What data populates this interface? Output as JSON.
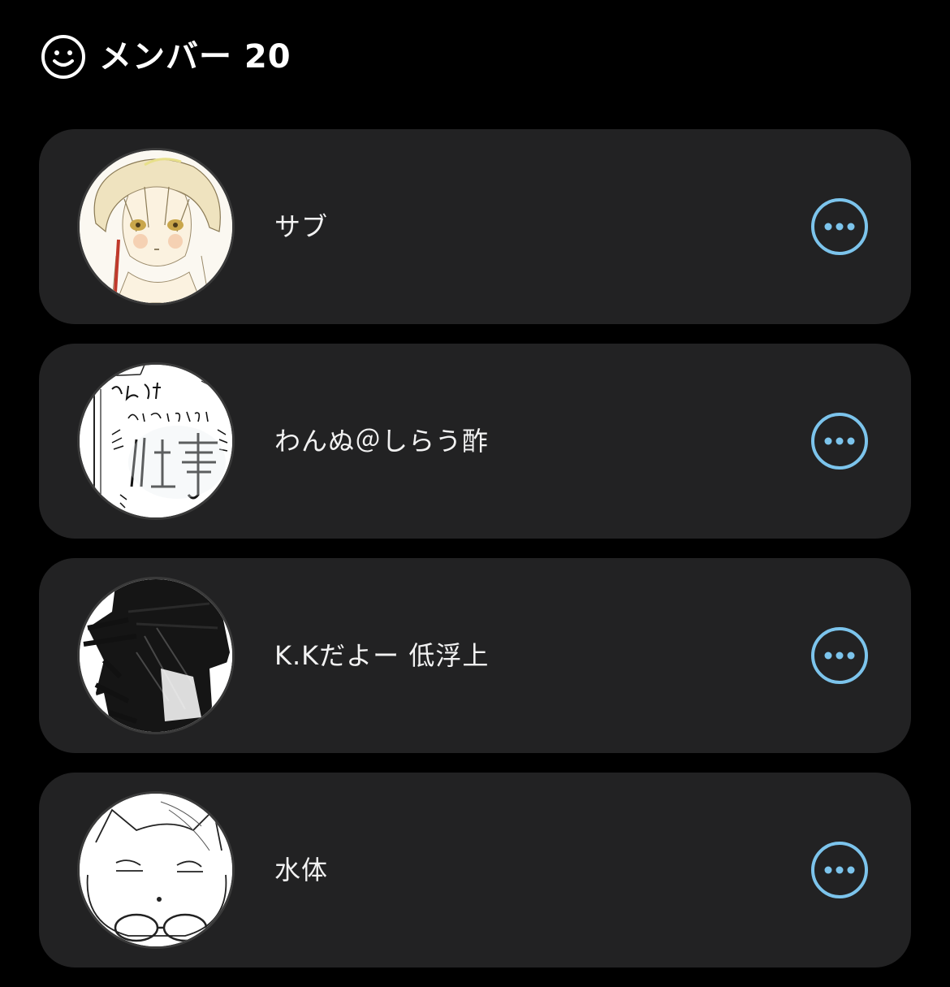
{
  "header": {
    "icon": "smile-face-icon",
    "title": "メンバー 20"
  },
  "colors": {
    "background": "#000000",
    "card": "#222223",
    "accent": "#7cc4ec",
    "text": "#f2f2f2"
  },
  "members": [
    {
      "name": "サブ",
      "avatar": "anime-boy-drawing-avatar",
      "action_icon": "more-options-icon"
    },
    {
      "name": "わんぬ＠しらう酢",
      "avatar": "handwritten-text-avatar",
      "action_icon": "more-options-icon"
    },
    {
      "name": "K.Kだよー 低浮上",
      "avatar": "dark-scribble-avatar",
      "action_icon": "more-options-icon"
    },
    {
      "name": "水体",
      "avatar": "cat-sketch-avatar",
      "action_icon": "more-options-icon"
    }
  ]
}
